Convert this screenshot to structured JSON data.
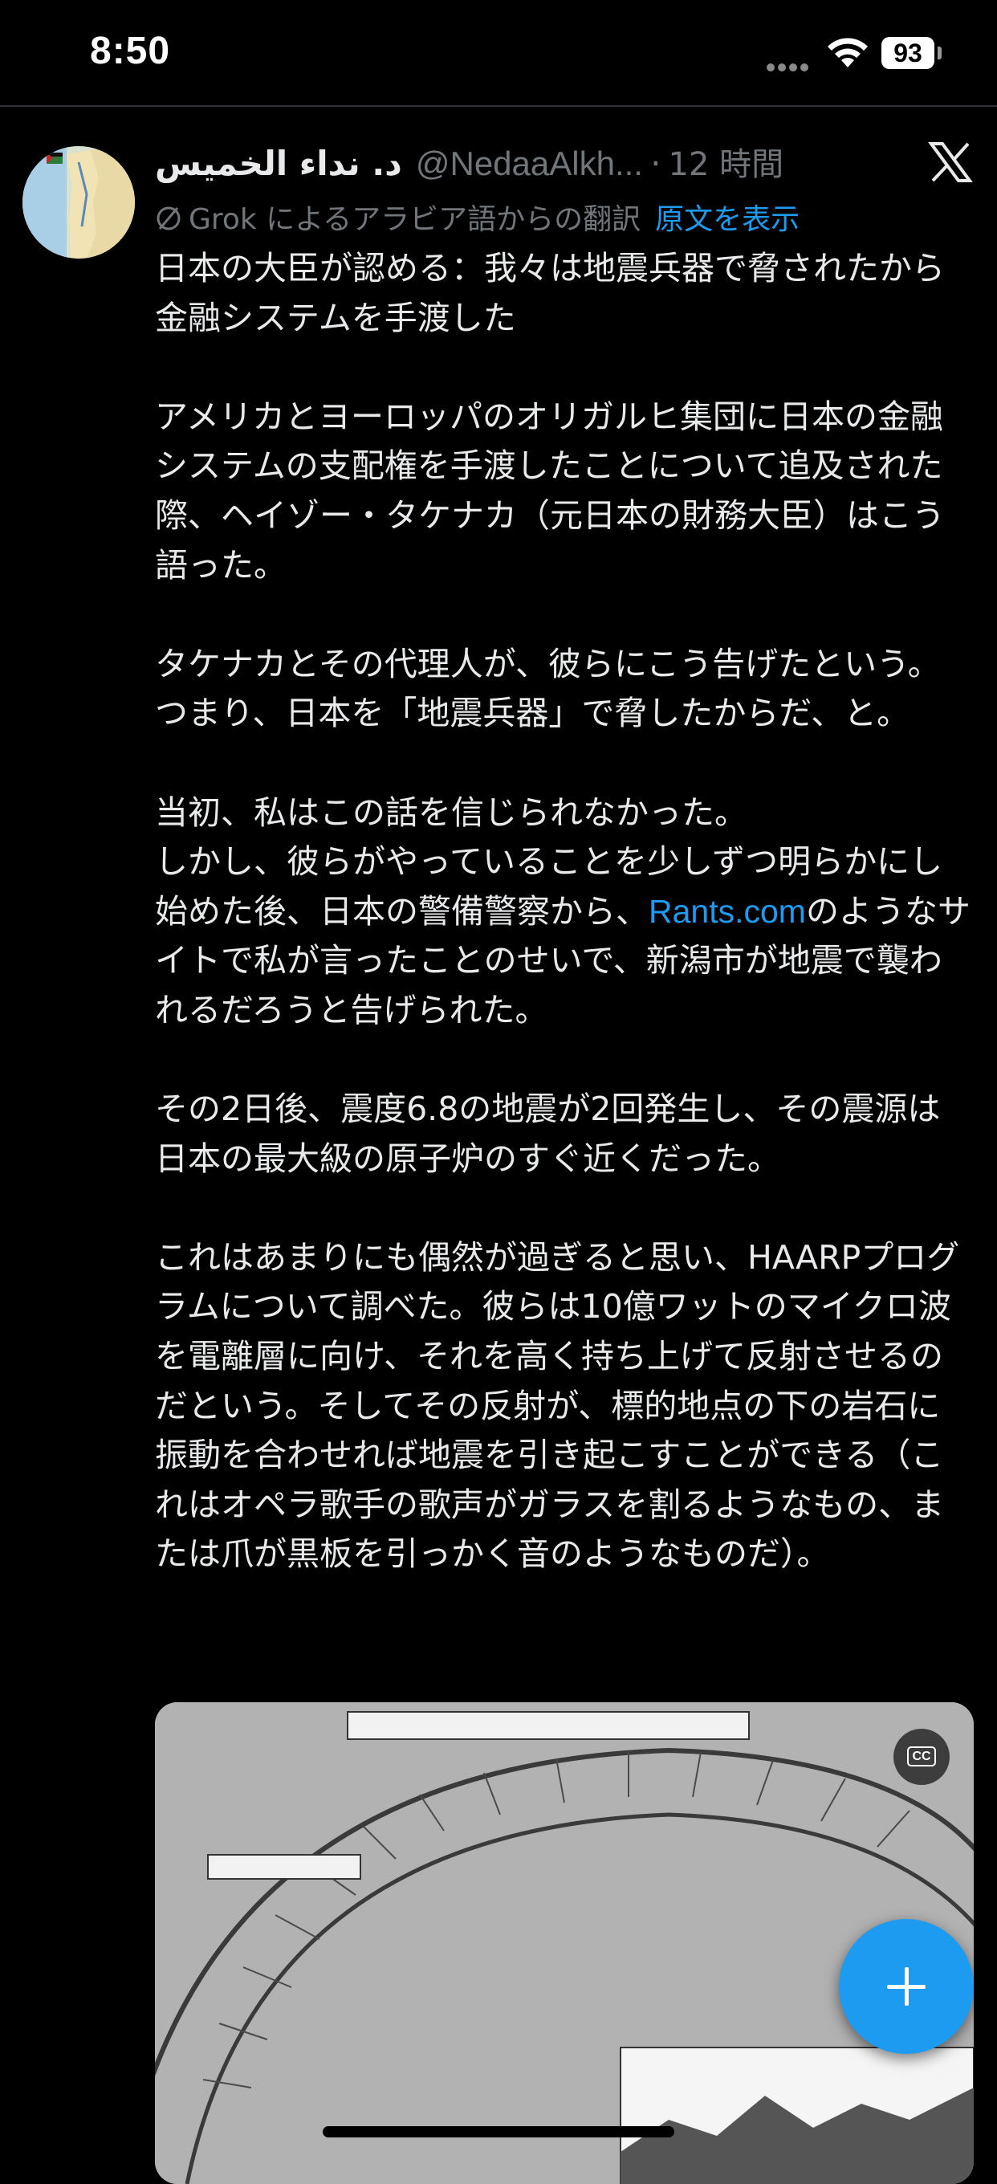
{
  "status_bar": {
    "time": "8:50",
    "battery": "93"
  },
  "post": {
    "display_name": "د. نداء الخميس",
    "handle": "@NedaaAlkh...",
    "separator": "·",
    "time_ago": "12 時間",
    "translation_label": "Grok によるアラビア語からの翻訳",
    "show_original": "原文を表示",
    "paragraphs": [
      "日本の大臣が認める：我々は地震兵器で脅されたから金融システムを手渡した",
      "アメリカとヨーロッパのオリガルヒ集団に日本の金融システムの支配権を手渡したことについて追及された際、ヘイゾー・タケナカ（元日本の財務大臣）はこう語った。",
      "タケナカとその代理人が、彼らにこう告げたという。つまり、日本を「地震兵器」で脅したからだ、と。"
    ],
    "para4_line1": "当初、私はこの話を信じられなかった。",
    "para4_line2_before": "しかし、彼らがやっていることを少しずつ明らかにし始めた後、日本の警備警察から、",
    "para4_link": "Rants.com",
    "para4_line2_after": "のようなサイトで私が言ったことのせいで、新潟市が地震で襲われるだろうと告げられた。",
    "paragraphs_end": [
      "その2日後、震度6.8の地震が2回発生し、その震源は日本の最大級の原子炉のすぐ近くだった。",
      "これはあまりにも偶然が過ぎると思い、HAARPプログラムについて調べた。彼らは10億ワットのマイクロ波を電離層に向け、それを高く持ち上げて反射させるのだという。そしてその反射が、標的地点の下の岩石に振動を合わせれば地震を引き起こすことができる（これはオペラ歌手の歌声がガラスを割るようなもの、または爪が黒板を引っかく音のようなものだ）。"
    ],
    "media_cc": "CC"
  },
  "icons": {
    "x_logo": "x-logo-icon",
    "no_icon": "prohibited-icon",
    "fab": "plus-icon"
  },
  "colors": {
    "accent": "#1d9bf0",
    "muted": "#71767b",
    "text": "#e7e9ea",
    "background": "#000000"
  }
}
